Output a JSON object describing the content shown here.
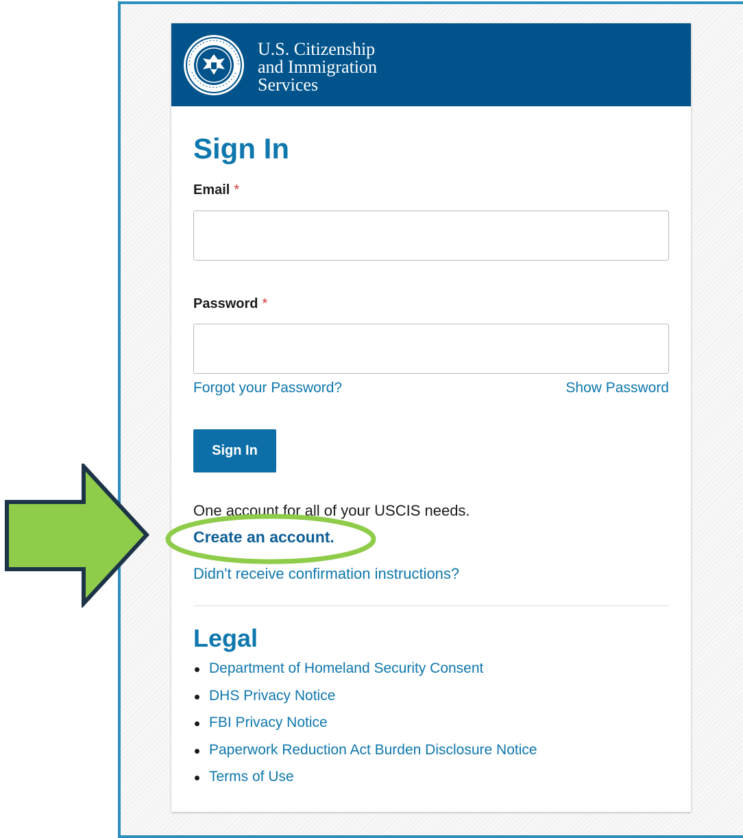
{
  "header": {
    "agency_line1": "U.S. Citizenship",
    "agency_line2": "and Immigration",
    "agency_line3": "Services",
    "seal_icon": "dhs-seal-icon"
  },
  "signin": {
    "title": "Sign In",
    "email_label": "Email",
    "password_label": "Password",
    "required_mark": "*",
    "email_value": "",
    "password_value": "",
    "forgot_link": "Forgot your Password?",
    "show_password_link": "Show Password",
    "signin_button": "Sign In",
    "account_text": "One account for all of your USCIS needs.",
    "create_account_link": "Create an account.",
    "confirmation_link": "Didn't receive confirmation instructions?"
  },
  "legal": {
    "title": "Legal",
    "links": [
      "Department of Homeland Security Consent",
      "DHS Privacy Notice",
      "FBI Privacy Notice",
      "Paperwork Reduction Act Burden Disclosure Notice",
      "Terms of Use"
    ]
  },
  "annotation": {
    "arrow_color": "#8fcc4a",
    "arrow_outline": "#1d3347",
    "ellipse_color": "#8fcc4a"
  },
  "colors": {
    "banner": "#00538b",
    "accent": "#0e77ad",
    "frame_border": "#2e8fbf"
  }
}
